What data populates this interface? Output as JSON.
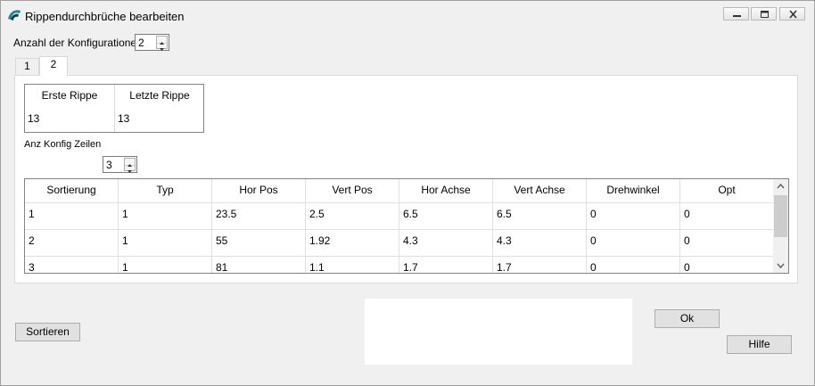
{
  "window": {
    "title": "Rippendurchbrüche bearbeiten",
    "controls": [
      "minimize-icon",
      "maximize-icon",
      "close-icon"
    ]
  },
  "config": {
    "label": "Anzahl der Konfigurationen",
    "value": "2"
  },
  "tabs": [
    {
      "label": "1",
      "active": false
    },
    {
      "label": "2",
      "active": true
    }
  ],
  "ribs": {
    "headers": [
      "Erste Rippe",
      "Letzte Rippe"
    ],
    "values": [
      "13",
      "13"
    ]
  },
  "rows_config": {
    "label": "Anz Konfig Zeilen",
    "value": "3"
  },
  "grid": {
    "headers": [
      "Sortierung",
      "Typ",
      "Hor Pos",
      "Vert Pos",
      "Hor Achse",
      "Vert Achse",
      "Drehwinkel",
      "Opt"
    ],
    "rows": [
      [
        "1",
        "1",
        "23.5",
        "2.5",
        "6.5",
        "6.5",
        "0",
        "0"
      ],
      [
        "2",
        "1",
        "55",
        "1.92",
        "4.3",
        "4.3",
        "0",
        "0"
      ],
      [
        "3",
        "1",
        "81",
        "1.1",
        "1.7",
        "1.7",
        "0",
        "0"
      ]
    ]
  },
  "buttons": {
    "sort": "Sortieren",
    "ok": "Ok",
    "help": "Hilfe"
  },
  "colors": {
    "window_bg": "#f0f0f0",
    "panel_bg": "#ffffff",
    "border": "#828282",
    "button_bg": "#e1e1e1"
  }
}
